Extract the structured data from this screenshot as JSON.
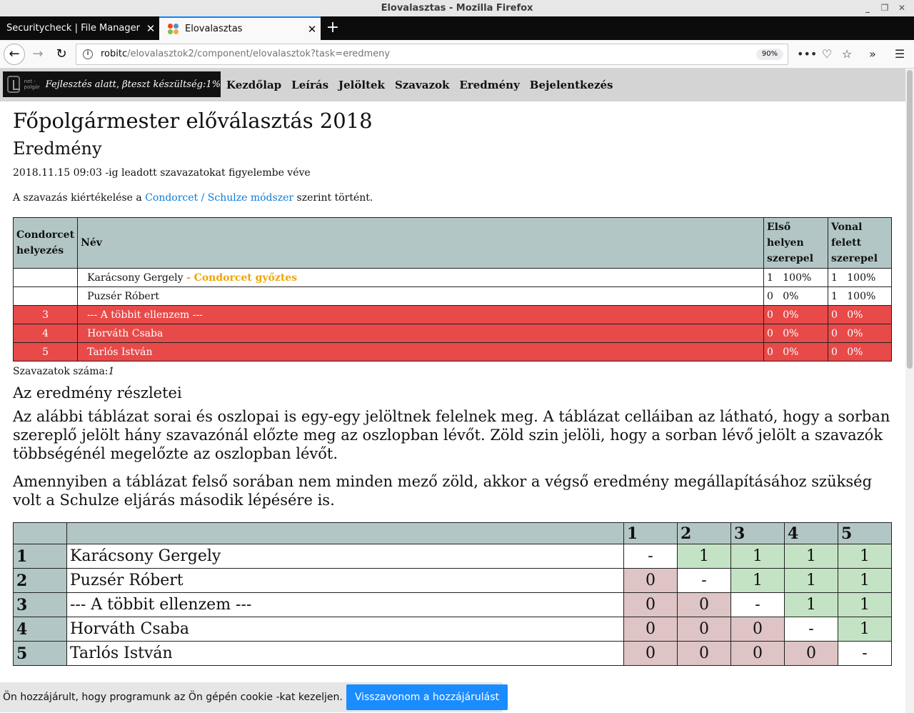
{
  "window": {
    "title": "Elovalasztas - Mozilla Firefox",
    "controls": {
      "minimize": "_",
      "maximize": "❐",
      "close": "✕"
    }
  },
  "tabs": [
    {
      "label": "Securitycheck | File Manager Con"
    },
    {
      "label": "Elovalasztas"
    }
  ],
  "toolbar": {
    "url_host": "robitc",
    "url_path": "/elovalasztok2/component/elovalasztok?task=eredmeny",
    "zoom": "90%"
  },
  "site": {
    "logo_brand": "net - polgár",
    "logo_tagline": "Fejlesztés alatt, βteszt készültség:1%",
    "menu": [
      "Kezdőlap",
      "Leírás",
      "Jelöltek",
      "Szavazok",
      "Eredmény",
      "Bejelentkezés"
    ]
  },
  "page": {
    "title": "Főpolgármester előválasztás 2018",
    "subtitle": "Eredmény",
    "timestamp": "2018.11.15 09:03 -ig leadott szavazatokat figyelembe véve",
    "method_prefix": "A szavazás kiértékelése a ",
    "method_link": "Condorcet / Schulze módszer",
    "method_suffix": " szerint történt."
  },
  "results": {
    "headers": {
      "rank_l1": "Condorcet",
      "rank_l2": "helyezés",
      "name": "Név",
      "first_l1": "Első",
      "first_l2": "helyen",
      "first_l3": "szerepel",
      "above_l1": "Vonal",
      "above_l2": "felett",
      "above_l3": "szerepel"
    },
    "winner_label": " - Condorcet győztes",
    "rows": [
      {
        "rank": "",
        "name": "Karácsony Gergely",
        "first": "1   100%",
        "above": "1   100%"
      },
      {
        "rank": "",
        "name": "Puzsér Róbert",
        "first": "0   0%",
        "above": "1   100%"
      },
      {
        "rank": "3",
        "name": "--- A többit ellenzem ---",
        "first": "0   0%",
        "above": "0   0%"
      },
      {
        "rank": "4",
        "name": "Horváth Csaba",
        "first": "0   0%",
        "above": "0   0%"
      },
      {
        "rank": "5",
        "name": "Tarlós István",
        "first": "0   0%",
        "above": "0   0%"
      }
    ],
    "vote_count_label": "Szavazatok száma:",
    "vote_count": "1"
  },
  "details": {
    "title": "Az eredmény részletei",
    "para1": "Az alábbi táblázat sorai és oszlopai is egy-egy jelöltnek felelnek meg. A táblázat celláiban az látható, hogy a sorban szereplő jelölt hány szavazónál előzte meg az oszlopban lévőt. Zöld szin jelöli, hogy a sorban lévő jelölt a szavazók többségénél megelőzte az oszlopban lévőt.",
    "para2": "Amennyiben a táblázat felső sorában nem minden mező zöld, akkor a végső eredmény megállapításához szükség volt a Schulze eljárás második lépésére is."
  },
  "matrix": {
    "col_headers": [
      "1",
      "2",
      "3",
      "4",
      "5"
    ],
    "rows": [
      {
        "rank": "1",
        "name": "Karácsony Gergely",
        "cells": [
          "-",
          "1",
          "1",
          "1",
          "1"
        ]
      },
      {
        "rank": "2",
        "name": "Puzsér Róbert",
        "cells": [
          "0",
          "-",
          "1",
          "1",
          "1"
        ]
      },
      {
        "rank": "3",
        "name": "--- A többit ellenzem ---",
        "cells": [
          "0",
          "0",
          "-",
          "1",
          "1"
        ]
      },
      {
        "rank": "4",
        "name": "Horváth Csaba",
        "cells": [
          "0",
          "0",
          "0",
          "-",
          "1"
        ]
      },
      {
        "rank": "5",
        "name": "Tarlós István",
        "cells": [
          "0",
          "0",
          "0",
          "0",
          "-"
        ]
      }
    ]
  },
  "cookie": {
    "text": "Ön hozzájárult, hogy programunk az Ön gépén cookie -kat kezeljen.",
    "button": "Visszavonom a hozzájárulást"
  },
  "colors": {
    "win_cell": "#c4e3c4",
    "lose_cell": "#dec4c4",
    "loser_row": "#e74a49",
    "header_bg": "#b3c6c6",
    "winner_tag": "#f0a500",
    "link": "#0a7bd8"
  }
}
